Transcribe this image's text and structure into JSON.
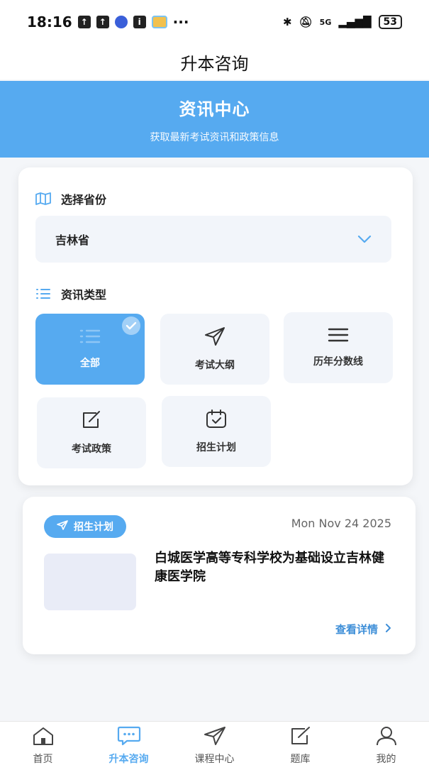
{
  "status_bar": {
    "time": "18:16",
    "dots": "···",
    "network": "5G",
    "battery": "53"
  },
  "header": {
    "title": "升本咨询"
  },
  "hero": {
    "title": "资讯中心",
    "subtitle": "获取最新考试资讯和政策信息"
  },
  "filters": {
    "province_label": "选择省份",
    "province_value": "吉林省",
    "type_label": "资讯类型",
    "types": [
      {
        "label": "全部",
        "icon": "list-icon",
        "active": true
      },
      {
        "label": "考试大纲",
        "icon": "send-icon",
        "active": false
      },
      {
        "label": "历年分数线",
        "icon": "menu-icon",
        "active": false
      },
      {
        "label": "考试政策",
        "icon": "edit-icon",
        "active": false
      },
      {
        "label": "招生计划",
        "icon": "calendar-check-icon",
        "active": false
      }
    ]
  },
  "news": {
    "tag": "招生计划",
    "date": "Mon Nov 24 2025",
    "title": "白城医学高等专科学校为基础设立吉林健康医学院",
    "more": "查看详情"
  },
  "bottom_nav": [
    {
      "label": "首页",
      "icon": "home-icon"
    },
    {
      "label": "升本咨询",
      "icon": "chat-icon",
      "active": true
    },
    {
      "label": "课程中心",
      "icon": "send-icon"
    },
    {
      "label": "题库",
      "icon": "edit-icon"
    },
    {
      "label": "我的",
      "icon": "user-icon"
    }
  ],
  "colors": {
    "accent": "#56aaf0",
    "link": "#3f8fd8"
  }
}
